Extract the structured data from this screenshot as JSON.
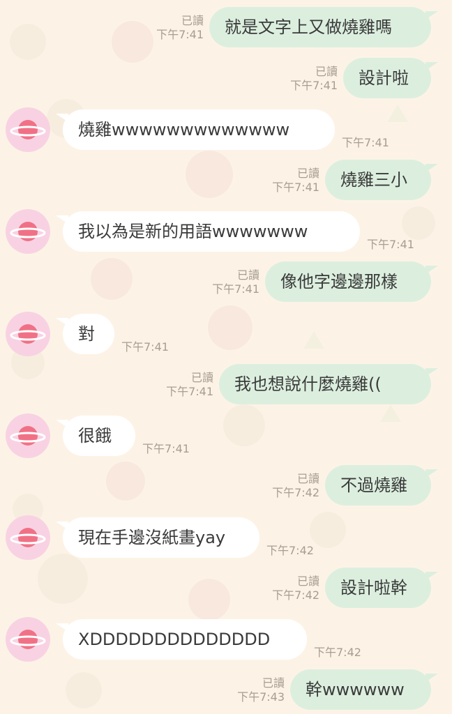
{
  "colors": {
    "background": "#fcf3e6",
    "outgoing_bubble": "#dcefdf",
    "incoming_bubble": "#ffffff",
    "avatar_bg": "#f8d2e3",
    "planet": "#f07186",
    "meta_text": "#a79d92"
  },
  "avatar_icon": "planet-icon",
  "messages": [
    {
      "direction": "out",
      "text": "就是文字上又做燒雞嗎",
      "read": "已讀",
      "time": "下午7:41"
    },
    {
      "direction": "out",
      "text": "設計啦",
      "read": "已讀",
      "time": "下午7:41"
    },
    {
      "direction": "in",
      "text": "燒雞wwwwwwwwwwwww",
      "time": "下午7:41"
    },
    {
      "direction": "out",
      "text": "燒雞三小",
      "read": "已讀",
      "time": "下午7:41"
    },
    {
      "direction": "in",
      "text": "我以為是新的用語wwwwwww",
      "time": "下午7:41"
    },
    {
      "direction": "out",
      "text": "像他字邊邊那樣",
      "read": "已讀",
      "time": "下午7:41"
    },
    {
      "direction": "in",
      "text": "對",
      "time": "下午7:41"
    },
    {
      "direction": "out",
      "text": "我也想說什麼燒雞((",
      "read": "已讀",
      "time": "下午7:41"
    },
    {
      "direction": "in",
      "text": "很餓",
      "time": "下午7:41"
    },
    {
      "direction": "out",
      "text": "不過燒雞",
      "read": "已讀",
      "time": "下午7:42"
    },
    {
      "direction": "in",
      "text": "現在手邊沒紙畫yay",
      "time": "下午7:42"
    },
    {
      "direction": "out",
      "text": "設計啦幹",
      "read": "已讀",
      "time": "下午7:42"
    },
    {
      "direction": "in",
      "text": "XDDDDDDDDDDDDDD",
      "time": "下午7:42"
    },
    {
      "direction": "out",
      "text": "幹wwwwww",
      "read": "已讀",
      "time": "下午7:43"
    }
  ]
}
